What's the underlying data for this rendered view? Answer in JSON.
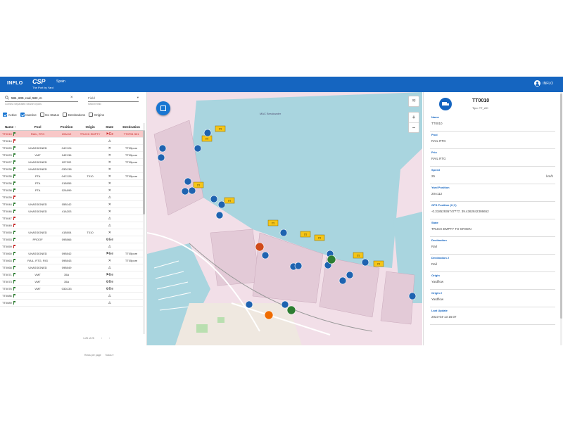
{
  "header": {
    "brand": "INFLO",
    "logo_main": "CSP",
    "logo_sub": "Spain",
    "logo_tagline": "The Port by Yard",
    "user_label": "INFLO"
  },
  "filters": {
    "search_value": "584, 609, real, 582, m",
    "search_hint": "Comma Separated Search Inputs",
    "field_select": "Field",
    "field_hint": "Search field",
    "checkboxes": [
      {
        "label": "Active",
        "checked": true
      },
      {
        "label": "Inactive",
        "checked": true
      },
      {
        "label": "No Status",
        "checked": false
      },
      {
        "label": "Destinations",
        "checked": false
      },
      {
        "label": "Origins",
        "checked": false
      }
    ]
  },
  "table": {
    "headers": [
      "Name ↑",
      "Pool",
      "Position",
      "Origin",
      "State",
      "Destination"
    ],
    "rows": [
      {
        "name": "TT0010",
        "flag": "green",
        "pool": "RAIL, RTG",
        "position": "20A112",
        "origin": "TRUCK EMPTY",
        "state": "⚑Ee",
        "destination": "TT0F51 501"
      },
      {
        "name": "TT0014",
        "flag": "red",
        "pool": "",
        "position": "",
        "origin": "",
        "state": "⚠",
        "destination": ""
      },
      {
        "name": "TT0020",
        "flag": "green",
        "pool": "UNASSIGNED",
        "position": "04C124",
        "origin": "",
        "state": "✕",
        "destination": "TT05pore"
      },
      {
        "name": "TT0023",
        "flag": "green",
        "pool": "VMT",
        "position": "04E136",
        "origin": "",
        "state": "✕",
        "destination": "TT05pore"
      },
      {
        "name": "TT0027",
        "flag": "green",
        "pool": "UNASSIGNED",
        "position": "02F202",
        "origin": "",
        "state": "✕",
        "destination": "TT05pore"
      },
      {
        "name": "TT0030",
        "flag": "green",
        "pool": "UNASSIGNED",
        "position": "03D138",
        "origin": "",
        "state": "✕",
        "destination": ""
      },
      {
        "name": "TT0035",
        "flag": "green",
        "pool": "PTA",
        "position": "04C126",
        "origin": "T010",
        "state": "✕",
        "destination": "TT05pore"
      },
      {
        "name": "TT0036",
        "flag": "green",
        "pool": "PTA",
        "position": "01B055",
        "origin": "",
        "state": "✕",
        "destination": ""
      },
      {
        "name": "TT0038",
        "flag": "green",
        "pool": "PTA",
        "position": "02A099",
        "origin": "",
        "state": "✕",
        "destination": ""
      },
      {
        "name": "TT0039",
        "flag": "red",
        "pool": "",
        "position": "",
        "origin": "",
        "state": "⚠",
        "destination": ""
      },
      {
        "name": "TT0044",
        "flag": "green",
        "pool": "UNASSIGNED",
        "position": "05B142",
        "origin": "",
        "state": "✕",
        "destination": ""
      },
      {
        "name": "TT0046",
        "flag": "green",
        "pool": "UNASSIGNED",
        "position": "41A203",
        "origin": "",
        "state": "✕",
        "destination": ""
      },
      {
        "name": "TT0047",
        "flag": "red",
        "pool": "",
        "position": "",
        "origin": "",
        "state": "⚠",
        "destination": ""
      },
      {
        "name": "TT0049",
        "flag": "red",
        "pool": "",
        "position": "",
        "origin": "",
        "state": "⚠",
        "destination": ""
      },
      {
        "name": "TT0050",
        "flag": "green",
        "pool": "UNASSIGNED",
        "position": "41B004",
        "origin": "T010",
        "state": "✕",
        "destination": ""
      },
      {
        "name": "TT0053",
        "flag": "green",
        "pool": "PROOF",
        "position": "09B066",
        "origin": "",
        "state": "⚙Ee",
        "destination": ""
      },
      {
        "name": "TT0059",
        "flag": "red",
        "pool": "",
        "position": "",
        "origin": "",
        "state": "⚠",
        "destination": ""
      },
      {
        "name": "TT0060",
        "flag": "green",
        "pool": "UNASSIGNED",
        "position": "09B042",
        "origin": "",
        "state": "⚑Ee",
        "destination": "TT05pore"
      },
      {
        "name": "TT0063",
        "flag": "green",
        "pool": "RAIL, RTG, RIG",
        "position": "09B043",
        "origin": "",
        "state": "✕",
        "destination": "TT05pore"
      },
      {
        "name": "TT0068",
        "flag": "green",
        "pool": "UNASSIGNED",
        "position": "09B049",
        "origin": "",
        "state": "⚠",
        "destination": ""
      },
      {
        "name": "TT0071",
        "flag": "green",
        "pool": "VMT",
        "position": "35A",
        "origin": "",
        "state": "⚑Ee",
        "destination": ""
      },
      {
        "name": "TT0073",
        "flag": "green",
        "pool": "VMT",
        "position": "35A",
        "origin": "",
        "state": "⚙Ee",
        "destination": ""
      },
      {
        "name": "TT0076",
        "flag": "green",
        "pool": "VMT",
        "position": "03D133",
        "origin": "",
        "state": "⚙Ee",
        "destination": ""
      },
      {
        "name": "TT0086",
        "flag": "green",
        "pool": "",
        "position": "",
        "origin": "",
        "state": "⚠",
        "destination": ""
      },
      {
        "name": "TT0089",
        "flag": "green",
        "pool": "",
        "position": "",
        "origin": "",
        "state": "⚠",
        "destination": ""
      }
    ],
    "pager_text": "1-25 of 25",
    "rows_per_page_label": "Rows per page",
    "rows_per_page_value": "Todos"
  },
  "map": {
    "water_label": "MAC Breakwater"
  },
  "details": {
    "title": "TT0010",
    "subtitle": "Tipo: TT_AH",
    "fields": [
      {
        "label": "Name",
        "value": "TT0010",
        "unit": ""
      },
      {
        "label": "Pool",
        "value": "RAIL RTG",
        "unit": ""
      },
      {
        "label": "Prio",
        "value": "RAIL RTG",
        "unit": ""
      },
      {
        "label": "Speed",
        "value": "25",
        "unit": "km/h"
      },
      {
        "label": "Yard Position",
        "value": "20A112",
        "unit": ""
      },
      {
        "label": "GPS Position (X,Y)",
        "value": "-0.31852936747777, 39.4362842386652",
        "unit": ""
      },
      {
        "label": "State",
        "value": "TRUCK EMPTY TO ORIGIN",
        "unit": ""
      },
      {
        "label": "Destination",
        "value": "Rail",
        "unit": ""
      },
      {
        "label": "Destination 2",
        "value": "Rail",
        "unit": ""
      },
      {
        "label": "Origin",
        "value": "Yardflow",
        "unit": ""
      },
      {
        "label": "Origin 2",
        "value": "Yardflow",
        "unit": ""
      },
      {
        "label": "Last Update",
        "value": "2023-04-13 16:07",
        "unit": ""
      }
    ]
  },
  "colors": {
    "header_bg": "#1565c0",
    "selected_row": "#f8c8c8",
    "water": "#a9d5df",
    "land": "#f2dfe8",
    "marker": "#1e63b0",
    "tag": "#f5c518"
  }
}
